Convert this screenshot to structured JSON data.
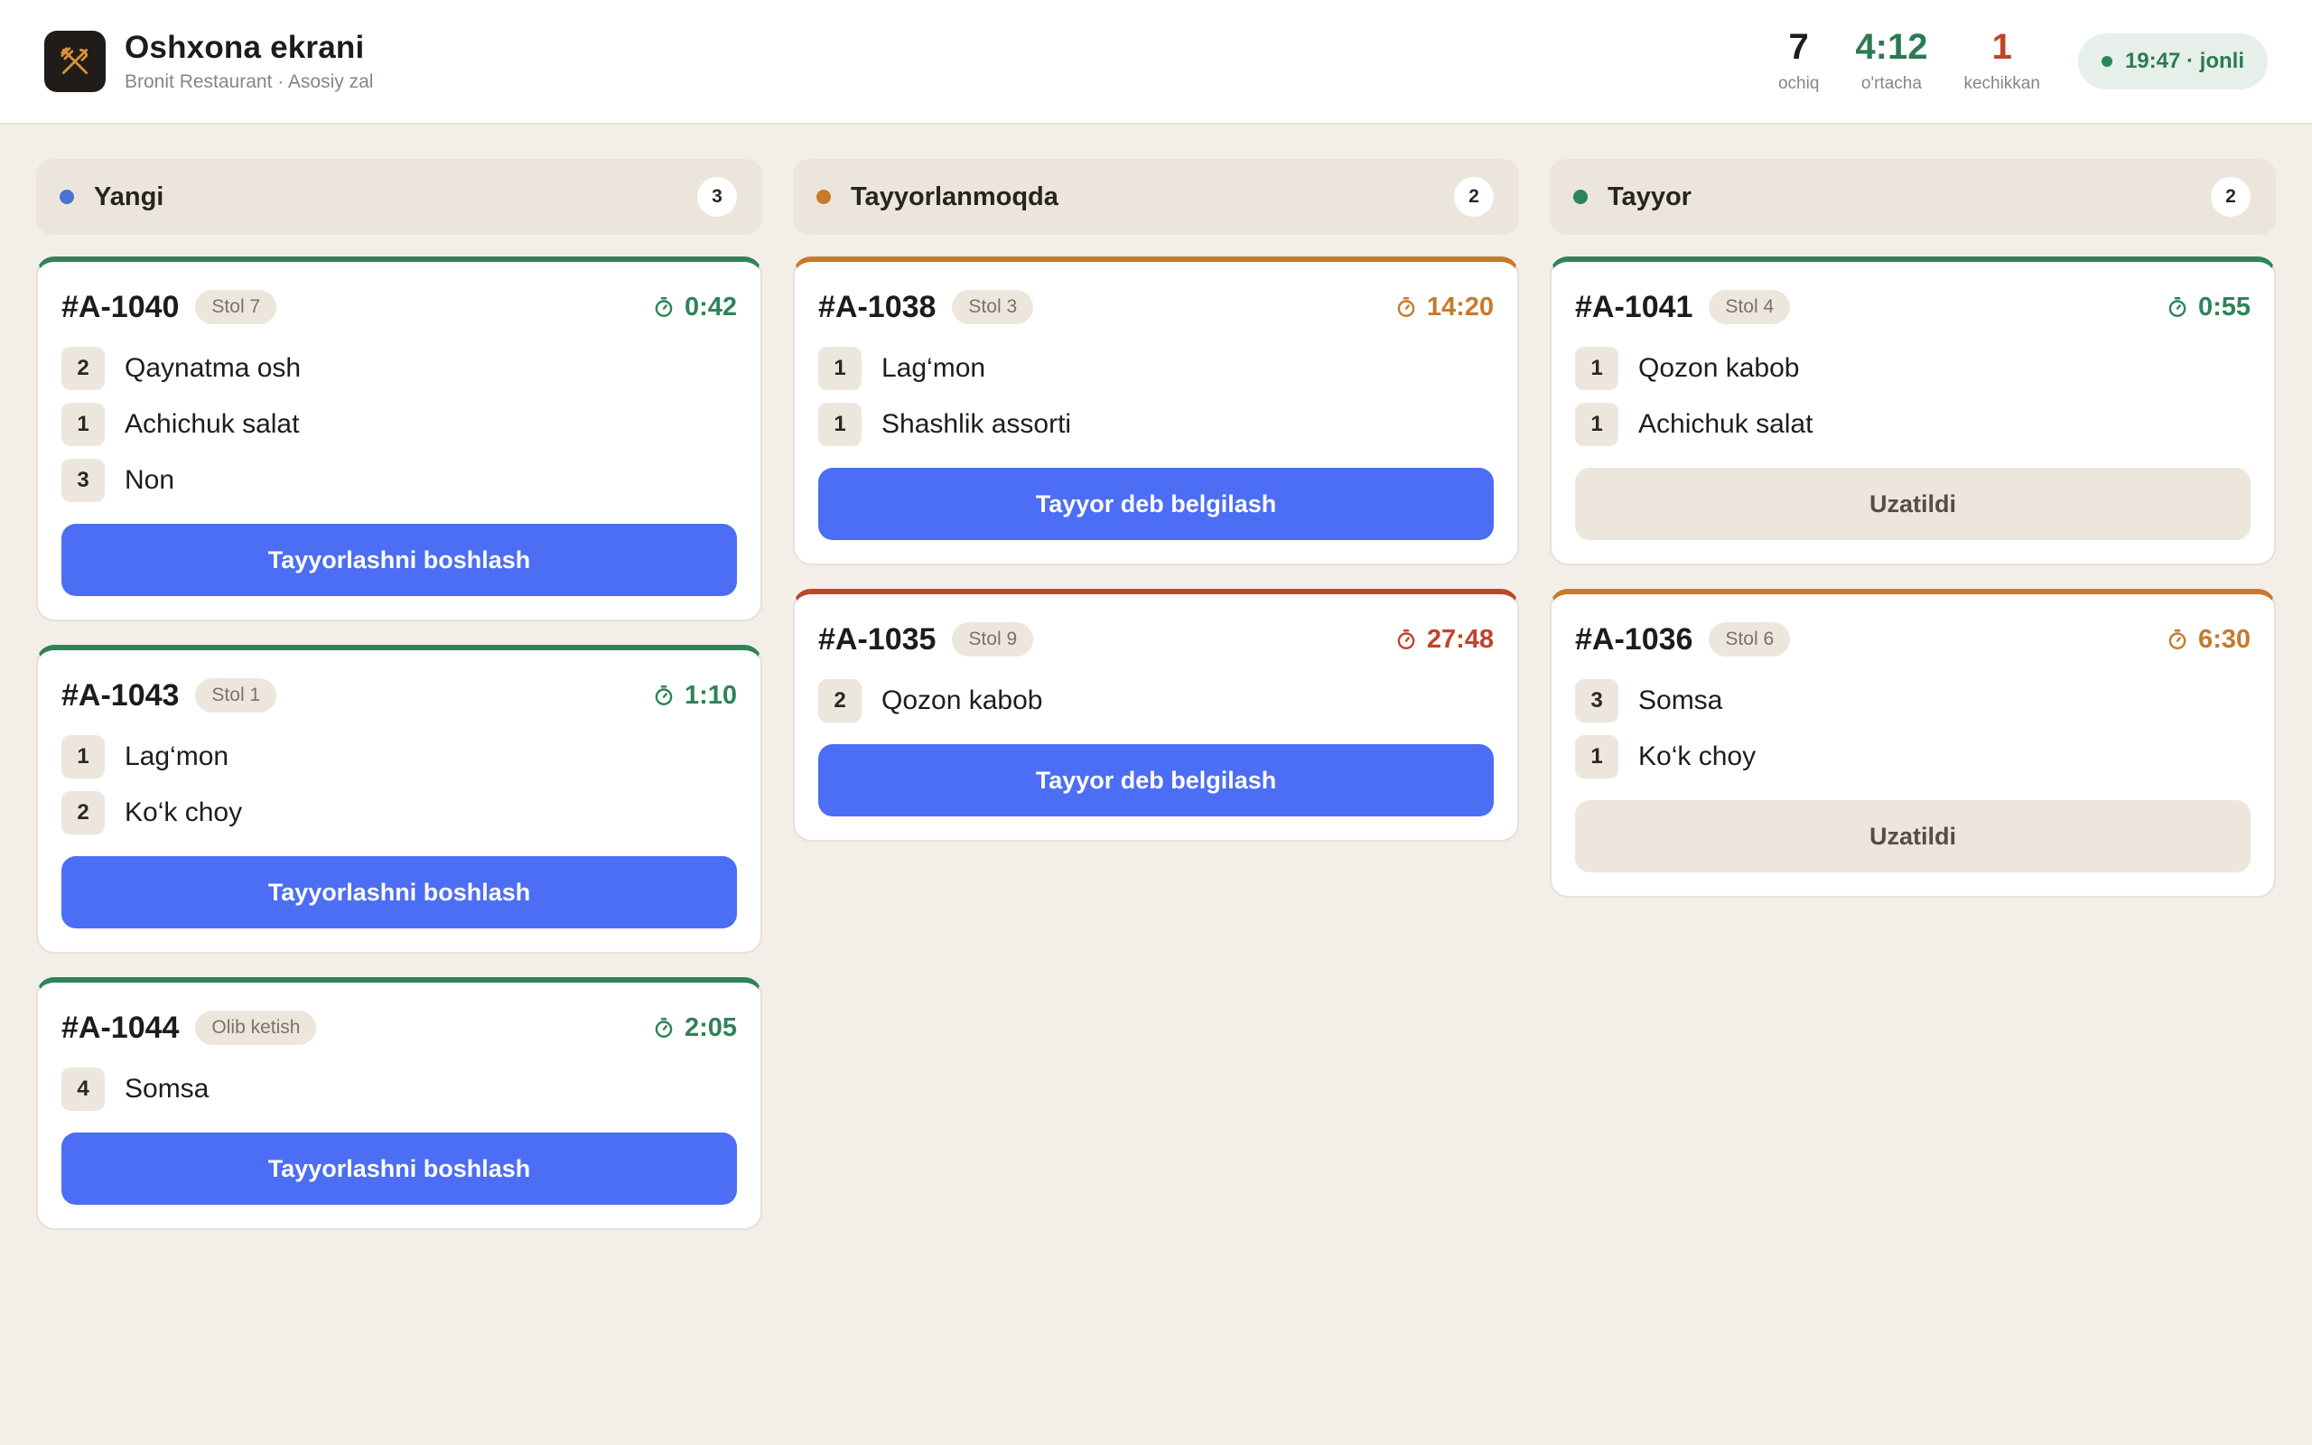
{
  "header": {
    "title": "Oshxona ekrani",
    "subtitle": "Bronit Restaurant · Asosiy zal",
    "stats": [
      {
        "value": "7",
        "label": "ochiq",
        "color": "#1e1c19"
      },
      {
        "value": "4:12",
        "label": "o'rtacha",
        "color": "#2c7a52"
      },
      {
        "value": "1",
        "label": "kechikkan",
        "color": "#c0432a"
      }
    ],
    "live": "19:47 · jonli"
  },
  "colors": {
    "accent": "#4c6ef4",
    "green": "#2e8358",
    "orange": "#c77a2a",
    "red": "#c0432a",
    "blue_dot": "#4a72d4"
  },
  "columns": [
    {
      "title": "Yangi",
      "count": "3",
      "dot": "#4a72d4",
      "cards": [
        {
          "id": "#A-1040",
          "tag": "Stol 7",
          "time": "0:42",
          "status": "green",
          "items": [
            {
              "qty": "2",
              "name": "Qaynatma osh"
            },
            {
              "qty": "1",
              "name": "Achichuk salat"
            },
            {
              "qty": "3",
              "name": "Non"
            }
          ],
          "action": "Tayyorlashni boshlash",
          "style": "primary"
        },
        {
          "id": "#A-1043",
          "tag": "Stol 1",
          "time": "1:10",
          "status": "green",
          "items": [
            {
              "qty": "1",
              "name": "Lag‘mon"
            },
            {
              "qty": "2",
              "name": "Ko‘k choy"
            }
          ],
          "action": "Tayyorlashni boshlash",
          "style": "primary"
        },
        {
          "id": "#A-1044",
          "tag": "Olib ketish",
          "time": "2:05",
          "status": "green",
          "items": [
            {
              "qty": "4",
              "name": "Somsa"
            }
          ],
          "action": "Tayyorlashni boshlash",
          "style": "primary"
        }
      ]
    },
    {
      "title": "Tayyorlanmoqda",
      "count": "2",
      "dot": "#c77a2a",
      "cards": [
        {
          "id": "#A-1038",
          "tag": "Stol 3",
          "time": "14:20",
          "status": "orange",
          "items": [
            {
              "qty": "1",
              "name": "Lag‘mon"
            },
            {
              "qty": "1",
              "name": "Shashlik assorti"
            }
          ],
          "action": "Tayyor deb belgilash",
          "style": "primary"
        },
        {
          "id": "#A-1035",
          "tag": "Stol 9",
          "time": "27:48",
          "status": "red",
          "items": [
            {
              "qty": "2",
              "name": "Qozon kabob"
            }
          ],
          "action": "Tayyor deb belgilash",
          "style": "primary"
        }
      ]
    },
    {
      "title": "Tayyor",
      "count": "2",
      "dot": "#2e8358",
      "cards": [
        {
          "id": "#A-1041",
          "tag": "Stol 4",
          "time": "0:55",
          "status": "green",
          "items": [
            {
              "qty": "1",
              "name": "Qozon kabob"
            },
            {
              "qty": "1",
              "name": "Achichuk salat"
            }
          ],
          "action": "Uzatildi",
          "style": "muted"
        },
        {
          "id": "#A-1036",
          "tag": "Stol 6",
          "time": "6:30",
          "status": "orange",
          "items": [
            {
              "qty": "3",
              "name": "Somsa"
            },
            {
              "qty": "1",
              "name": "Ko‘k choy"
            }
          ],
          "action": "Uzatildi",
          "style": "muted"
        }
      ]
    }
  ]
}
